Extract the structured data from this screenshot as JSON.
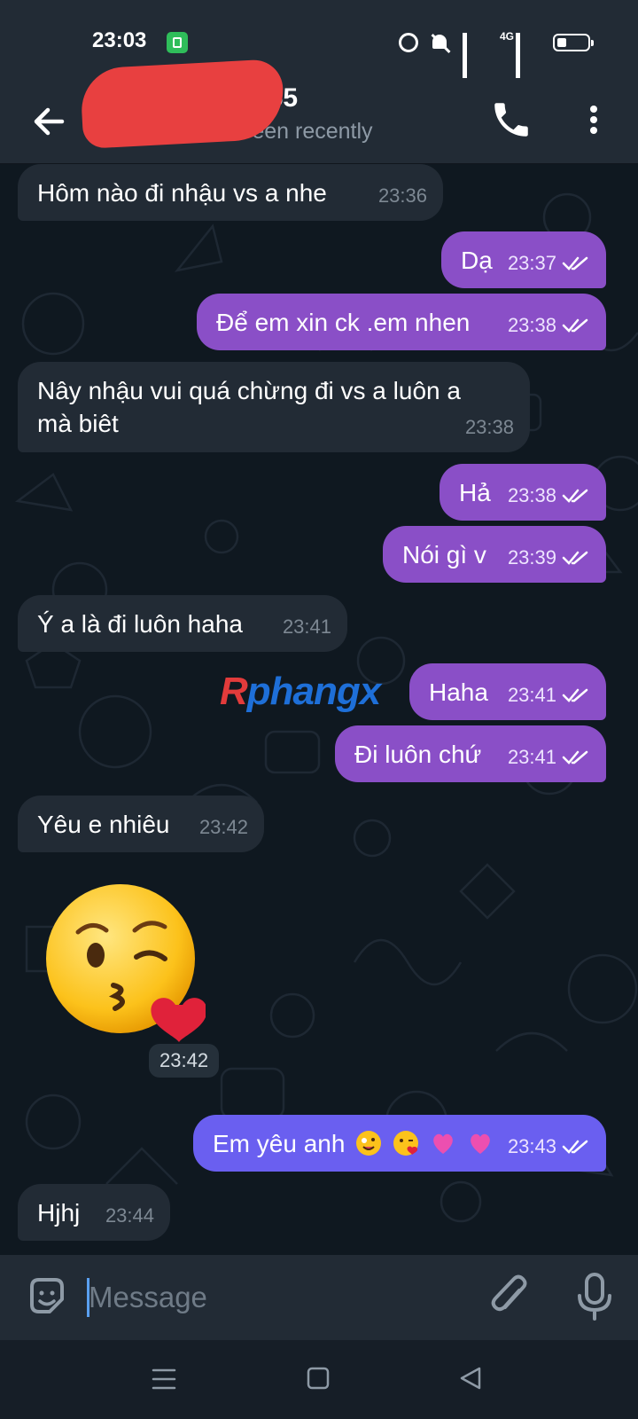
{
  "status_bar": {
    "time": "23:03",
    "network_label": "4G",
    "icons": [
      "wechat-icon",
      "alarm-icon",
      "mute-icon",
      "signal-icon",
      "signal-4g-icon",
      "battery-icon"
    ]
  },
  "header": {
    "contact_name": "…755",
    "status": "last seen recently",
    "icons": [
      "back-arrow-icon",
      "phone-icon",
      "more-vertical-icon"
    ]
  },
  "messages": [
    {
      "dir": "in",
      "text": "Hôm nào đi nhậu vs a nhe",
      "time": "23:36"
    },
    {
      "dir": "out",
      "text": "Dạ",
      "time": "23:37",
      "read": true
    },
    {
      "dir": "out",
      "text": "Để em xin ck .em nhen",
      "time": "23:38",
      "read": true
    },
    {
      "dir": "in",
      "text": "Nây nhậu vui quá chừng đi vs a luôn a mà biêt",
      "time": "23:38"
    },
    {
      "dir": "out",
      "text": "Hả",
      "time": "23:38",
      "read": true
    },
    {
      "dir": "out",
      "text": "Nói gì v",
      "time": "23:39",
      "read": true
    },
    {
      "dir": "in",
      "text": "Ý a là đi luôn haha",
      "time": "23:41"
    },
    {
      "dir": "out",
      "text": "Haha",
      "time": "23:41",
      "read": true
    },
    {
      "dir": "out",
      "text": "Đi luôn chứ",
      "time": "23:41",
      "read": true
    },
    {
      "dir": "in",
      "text": "Yêu e nhiêu",
      "time": "23:42"
    },
    {
      "dir": "in",
      "type": "sticker",
      "emoji": "face-blowing-a-kiss",
      "time": "23:42"
    },
    {
      "dir": "out",
      "text": "Em yêu anh",
      "emojis": [
        "zany-face",
        "face-blowing-a-kiss",
        "growing-heart",
        "growing-heart"
      ],
      "time": "23:43",
      "read": true
    },
    {
      "dir": "in",
      "text": "Hjhj",
      "time": "23:44"
    }
  ],
  "watermark": {
    "text": "phangx",
    "mark": "R"
  },
  "input_bar": {
    "placeholder": "Message",
    "icons": [
      "sticker-icon",
      "paperclip-icon",
      "microphone-icon"
    ]
  },
  "nav_bar": {
    "icons": [
      "menu-icon",
      "home-square-icon",
      "back-triangle-icon"
    ]
  },
  "colors": {
    "background": "#0f1820",
    "header": "#222b35",
    "incoming_bubble": "#222b35",
    "outgoing_bubble": "#8a4fc7",
    "outgoing_bubble_alt": "#6a5ff0",
    "secondary_text": "#8e9aa6"
  }
}
